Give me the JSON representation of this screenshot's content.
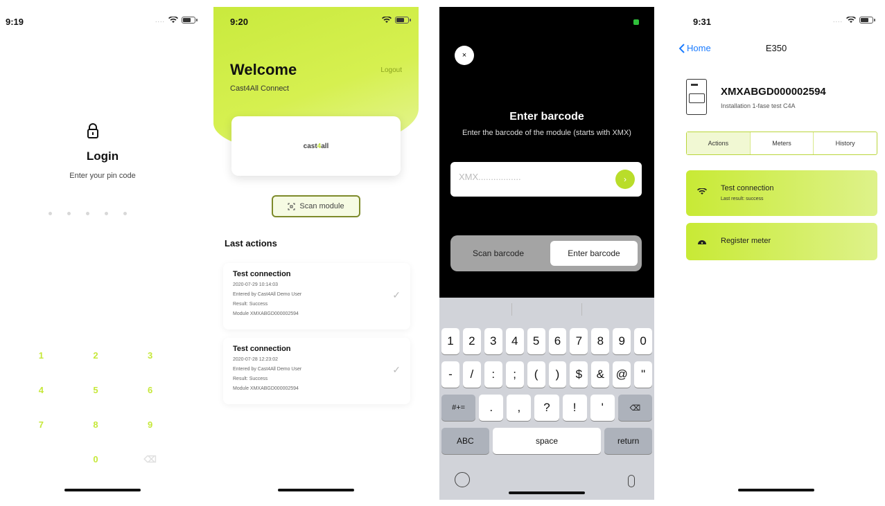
{
  "screen1": {
    "time": "9:19",
    "title": "Login",
    "subtitle": "Enter your pin code",
    "keypad": [
      "1",
      "2",
      "3",
      "4",
      "5",
      "6",
      "7",
      "8",
      "9",
      "",
      "0",
      "⌫"
    ]
  },
  "screen2": {
    "time": "9:20",
    "title": "Welcome",
    "app_name": "Cast4All Connect",
    "logout": "Logout",
    "logo_text_a": "cast",
    "logo_text_b": "4",
    "logo_text_c": "all",
    "scan_button": "Scan module",
    "section_title": "Last actions",
    "actions": [
      {
        "title": "Test connection",
        "date": "2020-07-29 10:14:03",
        "entered_by": "Entered by Cast4All Demo User",
        "result": "Result: Success",
        "module": "Module XMXABGD000002594"
      },
      {
        "title": "Test connection",
        "date": "2020-07-28 12:23:02",
        "entered_by": "Entered by Cast4All Demo User",
        "result": "Result: Success",
        "module": "Module XMXABGD000002594"
      }
    ]
  },
  "screen3": {
    "close": "×",
    "title": "Enter barcode",
    "subtitle": "Enter the barcode of the module (starts with XMX)",
    "placeholder": "XMX.................",
    "go": "›",
    "seg_left": "Scan barcode",
    "seg_right": "Enter barcode",
    "row1": [
      "1",
      "2",
      "3",
      "4",
      "5",
      "6",
      "7",
      "8",
      "9",
      "0"
    ],
    "row2": [
      "-",
      "/",
      ":",
      ";",
      "(",
      ")",
      "$",
      "&",
      "@",
      "\""
    ],
    "row3": [
      "#+=",
      ".",
      ",",
      "?",
      "!",
      "'",
      "⌫"
    ],
    "row4": [
      "ABC",
      "space",
      "return"
    ]
  },
  "screen4": {
    "time": "9:31",
    "back": "Home",
    "nav_title": "E350",
    "device_id": "XMXABGD000002594",
    "device_sub": "Installation 1-fase test C4A",
    "tabs": [
      "Actions",
      "Meters",
      "History"
    ],
    "btn1_title": "Test connection",
    "btn1_sub": "Last result: success",
    "btn2_title": "Register meter",
    "accent": "#c8ea35"
  }
}
